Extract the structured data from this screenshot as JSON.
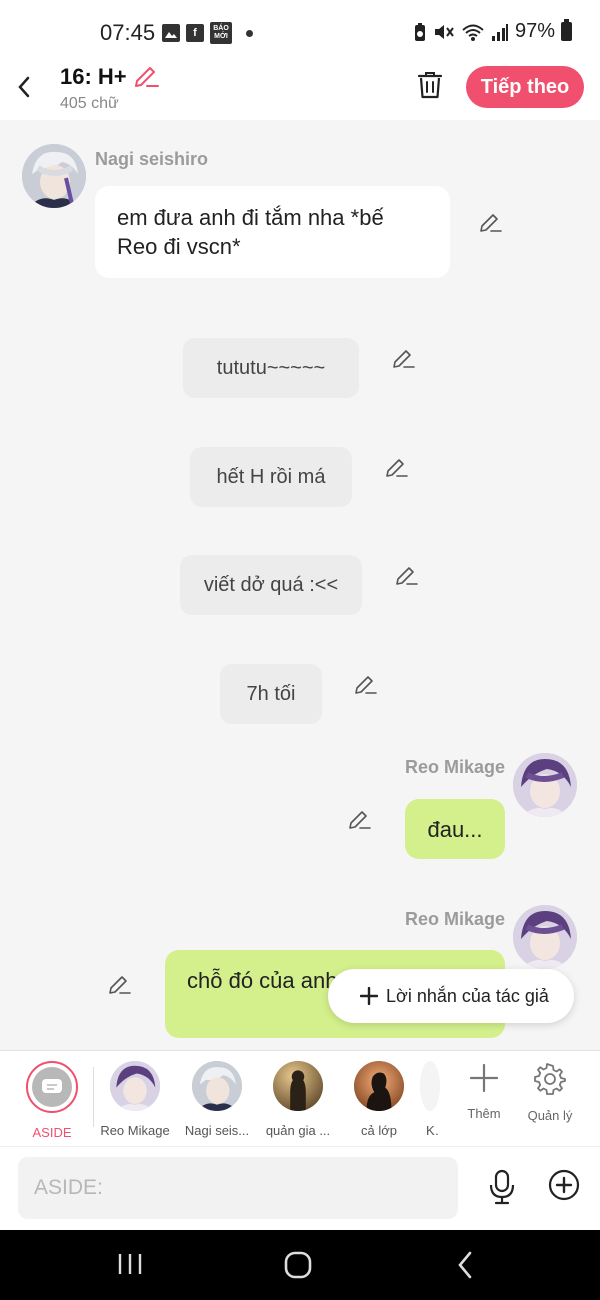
{
  "status_bar": {
    "time": "07:45",
    "fb_glyph": "f",
    "news_badge": "BÁO MỚI",
    "battery": "97%"
  },
  "header": {
    "title": "16: H+",
    "word_count": "405 chữ",
    "next_label": "Tiếp theo"
  },
  "chat": {
    "messages": [
      {
        "sender": "Nagi seishiro",
        "text": "em đưa anh đi tắm nha *bế Reo đi vscn*"
      },
      {
        "text": "tututu~~~~~"
      },
      {
        "text": "hết H rồi má"
      },
      {
        "text": "viết dở quá :<<"
      },
      {
        "text": "7h tối"
      },
      {
        "sender": "Reo Mikage",
        "text": "đau..."
      },
      {
        "sender": "Reo Mikage",
        "text": "chỗ đó của anh rồi."
      }
    ],
    "author_note_label": "Lời nhắn của tác giả"
  },
  "characters": {
    "items": [
      {
        "label": "ASIDE"
      },
      {
        "label": "Reo Mikage"
      },
      {
        "label": "Nagi seis..."
      },
      {
        "label": "quản gia ..."
      },
      {
        "label": "cả lớp"
      },
      {
        "label": "Ka"
      }
    ],
    "add_label": "Thêm",
    "manage_label": "Quản lý"
  },
  "input": {
    "placeholder": "ASIDE:"
  },
  "colors": {
    "accent": "#f0506e",
    "green_bubble": "#d4f08c",
    "aside_bubble": "#ececec"
  }
}
